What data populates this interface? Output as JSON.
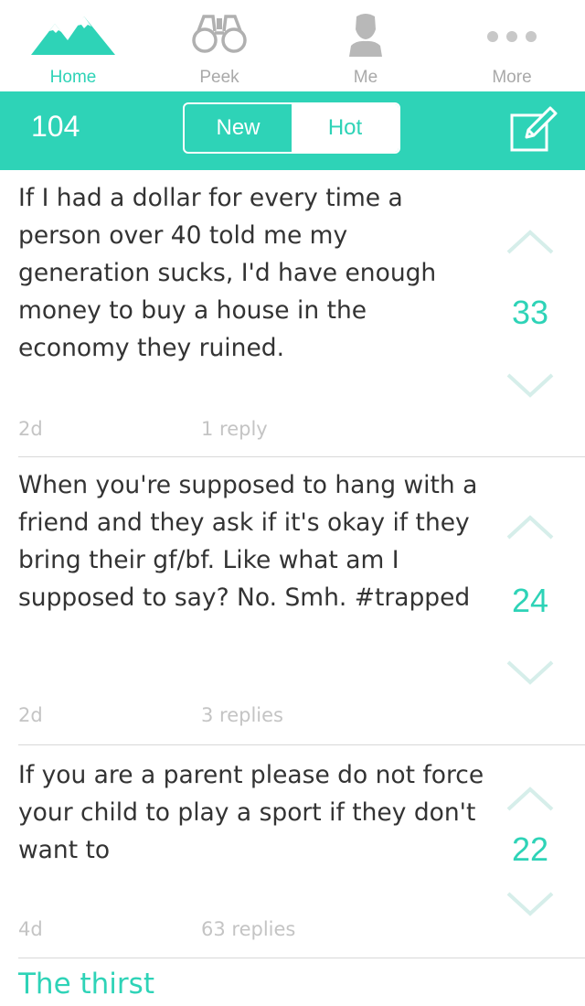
{
  "nav": {
    "items": [
      {
        "label": "Home",
        "icon": "mountains-icon",
        "active": true
      },
      {
        "label": "Peek",
        "icon": "binoculars-icon",
        "active": false
      },
      {
        "label": "Me",
        "icon": "person-icon",
        "active": false
      },
      {
        "label": "More",
        "icon": "more-dots-icon",
        "active": false
      }
    ]
  },
  "header": {
    "count": "104",
    "tabs": {
      "new": "New",
      "hot": "Hot"
    },
    "selected_tab": "Hot",
    "compose_icon": "compose-icon"
  },
  "colors": {
    "accent": "#2ed3b7",
    "muted": "#a9a9a9",
    "chevron": "#d6eeea"
  },
  "posts": [
    {
      "text": "If I had a dollar for every time a person over 40 told me my generation sucks, I'd have enough money to buy a house in the economy they ruined.",
      "votes": "33",
      "time": "2d",
      "replies": "1 reply"
    },
    {
      "text": "When you're supposed to hang with a friend and they ask if it's okay if they bring their gf/bf. Like what am I supposed to say? No. Smh. #trapped",
      "votes": "24",
      "time": "2d",
      "replies": "3 replies"
    },
    {
      "text": "If you are a parent please do not force your child to play a sport if they don't want to",
      "votes": "22",
      "time": "4d",
      "replies": "63 replies"
    }
  ],
  "next_post": {
    "text": "The thirst"
  }
}
